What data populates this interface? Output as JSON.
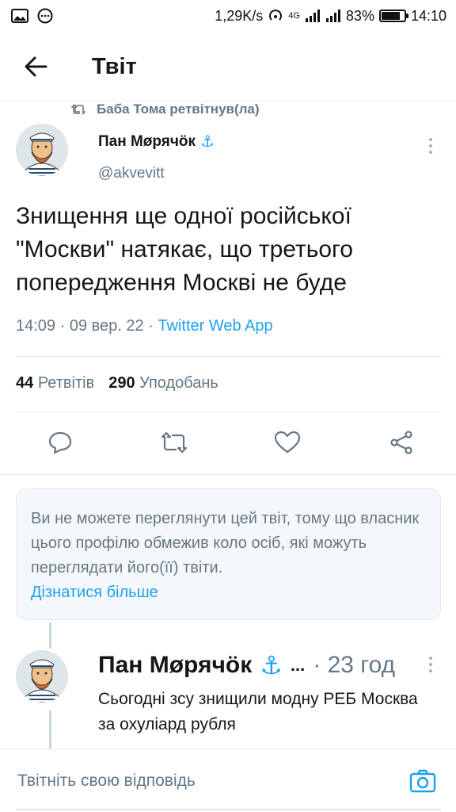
{
  "status_bar": {
    "speed": "1,29K/s",
    "network": "4G",
    "battery": "83%",
    "battery_level": 0.83,
    "time": "14:10"
  },
  "topbar": {
    "title": "Твіт"
  },
  "retweet": {
    "text": "Баба Тома ретвітнув(ла)"
  },
  "tweet": {
    "author_name": "Пан Мøрячöк",
    "author_emoji": "⚓",
    "handle": "@akvevitt",
    "text": "Знищення ще однoї російської \"Москви\" натякає, що третього попередження Москві не буде",
    "time": "14:09 · 09 вер. 22 · ",
    "source": "Twitter Web App",
    "retweets_count": "44",
    "retweets_label": "Ретвітів",
    "likes_count": "290",
    "likes_label": "Уподобань"
  },
  "notice": {
    "text": "Ви не можете переглянути цей твіт, тому що власник цього профілю обмежив коло осіб, які можуть переглядати його(її) твіти.",
    "link": "Дізнатися більше"
  },
  "reply_tweet": {
    "author_name": "Пан Мøрячöк",
    "author_emoji": "⚓",
    "ellipsis": "...",
    "time": "· 23 год",
    "text": "Сьогодні зсу знищили модну РЕБ Москва за охуліард рубля"
  },
  "reply_bar": {
    "placeholder": "Твітніть свою відповідь"
  },
  "colors": {
    "accent": "#1da1f2",
    "secondary_text": "#657786",
    "anchor": "#1da1f2"
  }
}
